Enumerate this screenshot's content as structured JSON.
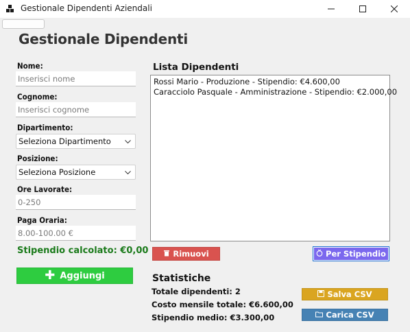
{
  "window": {
    "title": "Gestionale Dipendenti Aziendali",
    "icon": "app-grid-icon",
    "controls": [
      "minimize-icon",
      "maximize-icon",
      "close-icon"
    ]
  },
  "header": {
    "title": "Gestionale Dipendenti"
  },
  "form": {
    "nome": {
      "label": "Nome:",
      "placeholder": "Inserisci nome",
      "value": ""
    },
    "cognome": {
      "label": "Cognome:",
      "placeholder": "Inserisci cognome",
      "value": ""
    },
    "dipartimento": {
      "label": "Dipartimento:",
      "selected": "Seleziona Dipartimento"
    },
    "posizione": {
      "label": "Posizione:",
      "selected": "Seleziona Posizione"
    },
    "ore": {
      "label": "Ore Lavorate:",
      "placeholder": "0-250",
      "value": ""
    },
    "paga": {
      "label": "Paga Oraria:",
      "placeholder": "8.00-100.00 €",
      "value": ""
    },
    "stipendio": "Stipendio calcolato: €0,00",
    "add_label": "Aggiungi"
  },
  "list": {
    "title": "Lista Dipendenti",
    "items": [
      "Rossi Mario - Produzione - Stipendio: €4.600,00",
      "Caracciolo Pasquale - Amministrazione - Stipendio: €2.000,00"
    ],
    "remove_label": "Rimuovi",
    "sort_label": "Per Stipendio"
  },
  "stats": {
    "title": "Statistiche",
    "totale": "Totale dipendenti: 2",
    "costo": "Costo mensile totale: €6.600,00",
    "medio": "Stipendio medio: €3.300,00",
    "save_label": "Salva CSV",
    "load_label": "Carica CSV"
  },
  "colors": {
    "add": "#2ecc40",
    "remove": "#d9534f",
    "sort": "#7b68ee",
    "save": "#daa520",
    "load": "#4682b4",
    "salary_text": "#1a7a1a"
  }
}
